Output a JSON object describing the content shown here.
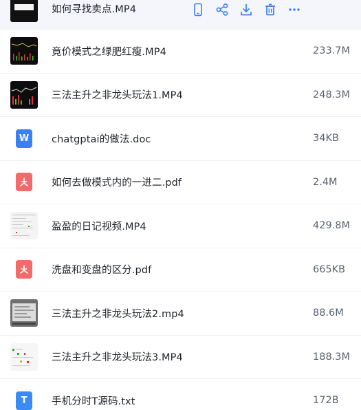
{
  "files": [
    {
      "name": "如何寻找卖点.MP4",
      "size": "",
      "kind": "video-thumb-dark",
      "actions": [
        "phone-icon",
        "share-icon",
        "download-icon",
        "delete-icon",
        "more-icon"
      ]
    },
    {
      "name": "竟价模式之绿肥红瘦.MP4",
      "size": "233.7M",
      "kind": "video-thumb-dark"
    },
    {
      "name": "三法主升之非龙头玩法1.MP4",
      "size": "248.3M",
      "kind": "video-thumb-dark"
    },
    {
      "name": "chatgptai的做法.doc",
      "size": "34KB",
      "kind": "word-icon"
    },
    {
      "name": "如何去做模式内的一进二.pdf",
      "size": "2.4M",
      "kind": "pdf-icon"
    },
    {
      "name": "盈盈的日记视频.MP4",
      "size": "429.8M",
      "kind": "video-thumb-light"
    },
    {
      "name": "洗盘和变盘的区分.pdf",
      "size": "665KB",
      "kind": "pdf-icon"
    },
    {
      "name": "三法主升之非龙头玩法2.mp4",
      "size": "88.6M",
      "kind": "video-thumb-gray"
    },
    {
      "name": "三法主升之非龙头玩法3.MP4",
      "size": "188.3M",
      "kind": "video-thumb-light"
    },
    {
      "name": "手机分时T源码.txt",
      "size": "172B",
      "kind": "txt-icon"
    }
  ],
  "colors": {
    "accent": "#3b7ff5",
    "pdf": "#f16b6b",
    "highlight_row": "#f4f6fb"
  }
}
